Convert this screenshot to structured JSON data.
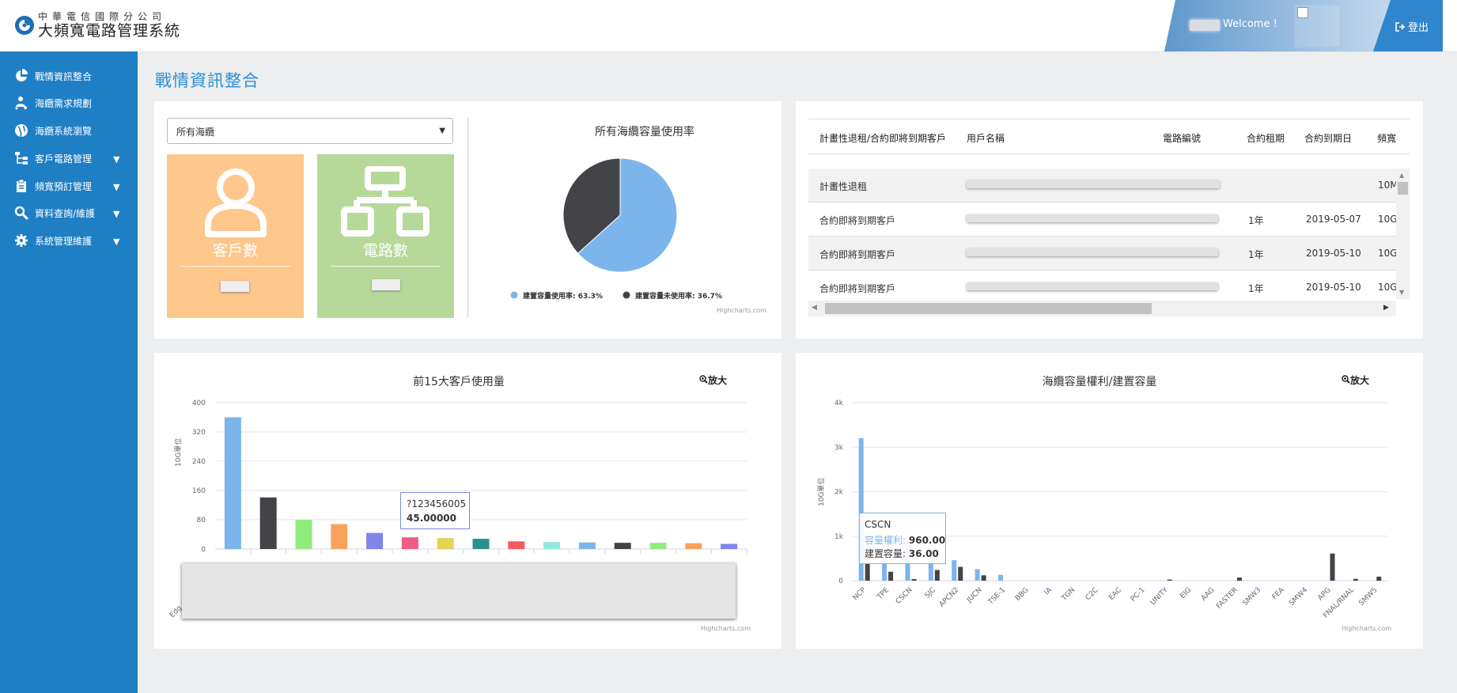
{
  "header": {
    "logo_small": "中華電信國際分公司",
    "logo_big": "大頻寬電路管理系統",
    "welcome": "Welcome !",
    "logout": "登出"
  },
  "sidebar": {
    "items": [
      {
        "label": "戰情資訊整合",
        "icon": "pie-chart-icon"
      },
      {
        "label": "海纜需求規劃",
        "icon": "user-network-icon"
      },
      {
        "label": "海纜系統瀏覽",
        "icon": "globe-icon"
      },
      {
        "label": "客戶電路管理",
        "icon": "sitemap-icon"
      },
      {
        "label": "頻寬預訂管理",
        "icon": "clipboard-icon"
      },
      {
        "label": "資料查詢/維護",
        "icon": "search-icon"
      },
      {
        "label": "系統管理維護",
        "icon": "gear-icon"
      }
    ]
  },
  "page": {
    "title": "戰情資訊整合"
  },
  "filter": {
    "selected": "所有海纜"
  },
  "stats": {
    "customers_label": "客戶數",
    "circuits_label": "電路數"
  },
  "colors": {
    "sidebar": "#1f7fc4",
    "customers_card": "#fec78c",
    "circuits_card": "#b6d99a",
    "series_blue": "#7cb5ec",
    "series_dark": "#434348"
  },
  "pie": {
    "credits": "Highcharts.com",
    "chart_data": {
      "type": "pie",
      "title": "所有海纜容量使用率",
      "slices": [
        {
          "name": "建置容量使用率: 63.3%",
          "value": 63.3,
          "color": "#7cb5ec"
        },
        {
          "name": "建置容量未使用率: 36.7%",
          "value": 36.7,
          "color": "#434348"
        }
      ]
    }
  },
  "table": {
    "headers": [
      "計畫性退租/合約即將到期客戶",
      "用戶名稱",
      "電路編號",
      "合約租期",
      "合約到期日",
      "頻寬"
    ],
    "rows": [
      {
        "type": "計畫性退租",
        "term": "",
        "date": "",
        "bw": "10M"
      },
      {
        "type": "合約即將到期客戶",
        "term": "1年",
        "date": "2019-05-07",
        "bw": "10G"
      },
      {
        "type": "合約即將到期客戶",
        "term": "1年",
        "date": "2019-05-10",
        "bw": "10G"
      },
      {
        "type": "合約即將到期客戶",
        "term": "1年",
        "date": "2019-05-10",
        "bw": "10G"
      }
    ]
  },
  "top15": {
    "zoom_label": "放大",
    "credits": "Highcharts.com",
    "tooltip_name": "?123456005",
    "tooltip_value": "45.00000",
    "axis_first_label": "Edg",
    "chart_data": {
      "type": "bar",
      "title": "前15大客戶使用量",
      "ylabel": "10G單位",
      "ylim": [
        0,
        400
      ],
      "yticks": [
        0,
        80,
        160,
        240,
        320,
        400
      ],
      "values": [
        360,
        141,
        80,
        68,
        44,
        32,
        30,
        28,
        21,
        19,
        18,
        17,
        17,
        16,
        14
      ],
      "colors": [
        "#7cb5ec",
        "#434348",
        "#90ed7d",
        "#f7a35c",
        "#8085e9",
        "#f15c80",
        "#e4d354",
        "#2b908f",
        "#f45b5b",
        "#91e8e1",
        "#7cb5ec",
        "#434348",
        "#90ed7d",
        "#f7a35c",
        "#8085e9"
      ]
    }
  },
  "capacity": {
    "zoom_label": "放大",
    "credits": "Highcharts.com",
    "tooltip": {
      "name": "CSCN",
      "s1_label": "容量權利:",
      "s1_value": "960.00",
      "s2_label": "建置容量:",
      "s2_value": "36.00"
    },
    "chart_data": {
      "type": "bar",
      "title": "海纜容量權利/建置容量",
      "ylabel": "10G單位",
      "ylim": [
        0,
        4000
      ],
      "yticks": [
        "0",
        "1k",
        "2k",
        "3k",
        "4k"
      ],
      "categories": [
        "NCP",
        "TPE",
        "CSCN",
        "SJC",
        "APCN2",
        "JUCN",
        "TSE-1",
        "BBG",
        "IA",
        "TGN",
        "C2C",
        "EAC",
        "PC-1",
        "UNITY",
        "EIG",
        "AAG",
        "FASTER",
        "SMW3",
        "FEA",
        "SMW4",
        "APG",
        "FNAL/RNAL",
        "SMW5"
      ],
      "series": [
        {
          "name": "容量權利",
          "color": "#7cb5ec",
          "values": [
            3200,
            520,
            960,
            480,
            460,
            260,
            130,
            0,
            0,
            0,
            0,
            0,
            0,
            0,
            0,
            0,
            0,
            0,
            0,
            0,
            0,
            0,
            0
          ]
        },
        {
          "name": "建置容量",
          "color": "#434348",
          "values": [
            380,
            200,
            36,
            240,
            310,
            120,
            0,
            0,
            0,
            0,
            0,
            0,
            0,
            25,
            0,
            0,
            70,
            0,
            0,
            0,
            610,
            40,
            90
          ]
        }
      ]
    }
  }
}
